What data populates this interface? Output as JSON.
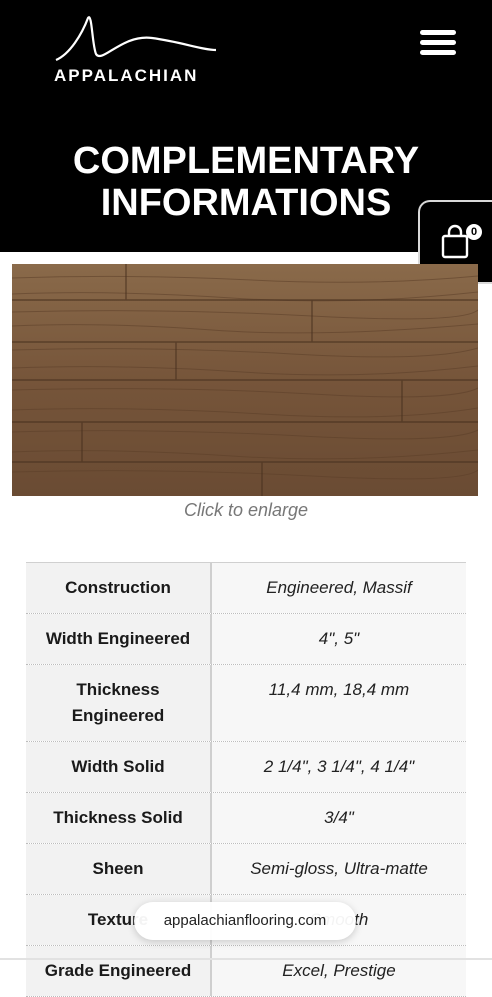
{
  "brand": {
    "name": "APPALACHIAN"
  },
  "page": {
    "title_line1": "COMPLEMENTARY",
    "title_line2": "INFORMATIONS"
  },
  "cart": {
    "count": "0"
  },
  "product_image": {
    "caption": "Click to enlarge"
  },
  "specs": [
    {
      "label": "Construction",
      "value": "Engineered, Massif"
    },
    {
      "label": "Width Engineered",
      "value": "4\", 5\""
    },
    {
      "label": "Thickness Engineered",
      "value": "11,4 mm, 18,4 mm"
    },
    {
      "label": "Width Solid",
      "value": "2 1/4\", 3 1/4\", 4 1/4\""
    },
    {
      "label": "Thickness Solid",
      "value": "3/4\""
    },
    {
      "label": "Sheen",
      "value": "Semi-gloss, Ultra-matte"
    },
    {
      "label": "Texture",
      "value": "Smooth"
    },
    {
      "label": "Grade Engineered",
      "value": "Excel, Prestige"
    }
  ],
  "browser": {
    "url": "appalachianflooring.com"
  },
  "colors": {
    "header_bg": "#000000",
    "wood": "#7a5a3d"
  }
}
